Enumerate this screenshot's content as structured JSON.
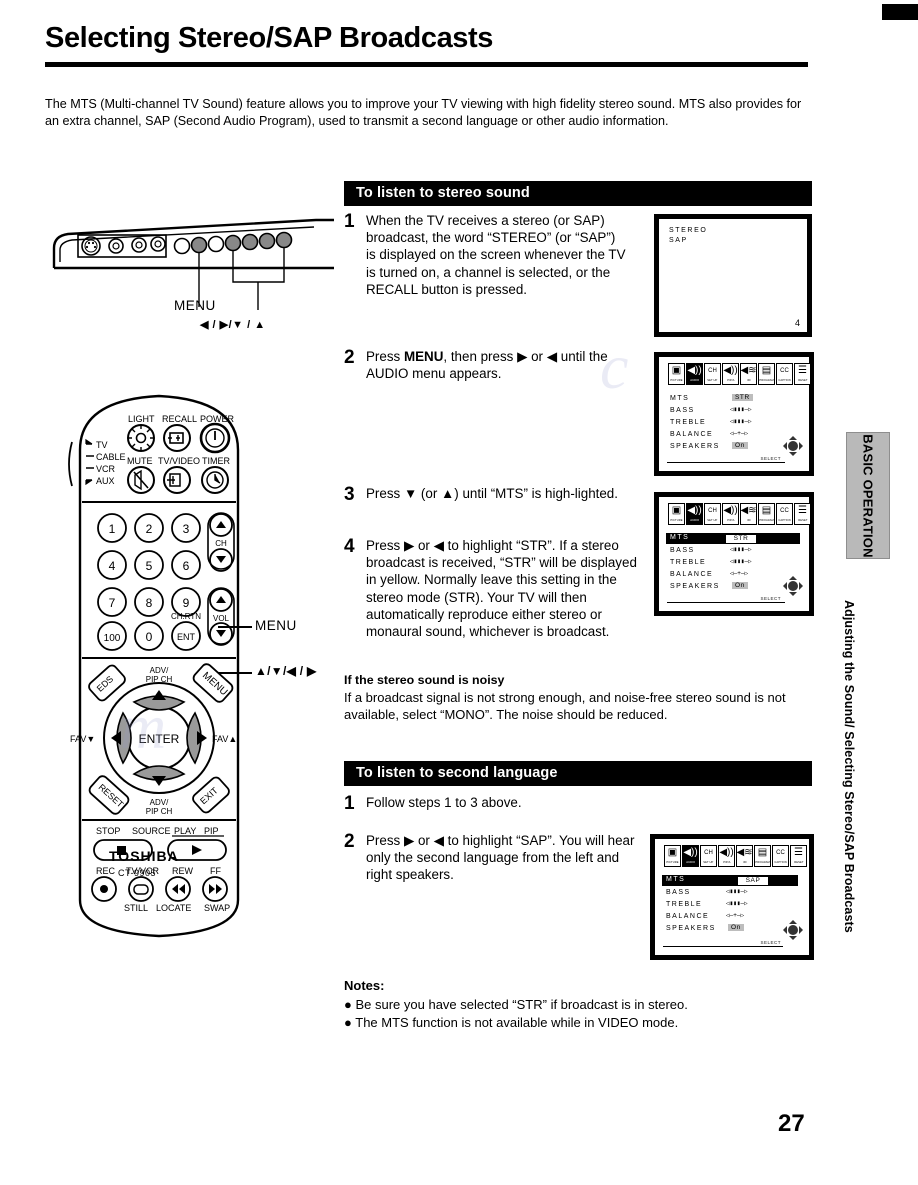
{
  "page": {
    "title": "Selecting Stereo/SAP Broadcasts",
    "number": "27",
    "intro": "The MTS (Multi-channel TV Sound) feature allows you to improve your TV viewing with high fidelity stereo sound. MTS also provides for an extra channel, SAP (Second Audio Program), used to transmit a second language or other audio information.",
    "side_tab": "BASIC OPERATION",
    "side_running_head": "Adjusting the Sound/ Selecting Stereo/SAP Broadcasts"
  },
  "tv_panel": {
    "menu_label": "MENU",
    "arrows_label": "◀ / ▶/▼ / ▲"
  },
  "remote": {
    "brand": "TOSHIBA",
    "model": "CT-9905",
    "menu_callout": "MENU",
    "arrows_callout": "▲/▼/◀ / ▶",
    "mode_labels": [
      "TV",
      "CABLE",
      "VCR",
      "AUX"
    ],
    "top_row_labels": [
      "LIGHT",
      "RECALL",
      "POWER"
    ],
    "second_row_labels": [
      "MUTE",
      "TV/VIDEO",
      "TIMER"
    ],
    "keypad": [
      "1",
      "2",
      "3",
      "4",
      "5",
      "6",
      "7",
      "8",
      "9",
      "100",
      "0",
      "ENT"
    ],
    "ent_label": "CH.RTN",
    "ch_label": "CH",
    "vol_label": "VOL",
    "dpad": {
      "center": "ENTER",
      "top_label": "ADV/\nPIP CH",
      "bottom_label": "ADV/\nPIP CH",
      "left_label": "FAV▼",
      "right_label": "FAV▲",
      "corner_tl": "EDS",
      "corner_tr": "MENU",
      "corner_bl": "RESET",
      "corner_br": "EXIT"
    },
    "transport": {
      "stop": "STOP",
      "source": "SOURCE",
      "play": "PLAY",
      "pip": "PIP",
      "rec": "REC",
      "tvvcr": "TV/VCR",
      "rew": "REW",
      "ff": "FF",
      "still": "STILL",
      "locate": "LOCATE",
      "swap": "SWAP"
    }
  },
  "section_stereo": {
    "heading": "To listen to stereo sound",
    "steps": [
      {
        "num": "1",
        "text": "When the TV receives a stereo (or SAP) broadcast, the word “STEREO” (or “SAP”) is displayed on the screen whenever the TV is turned on, a channel is selected, or the RECALL button is pressed."
      },
      {
        "num": "2",
        "text_before": "Press ",
        "bold": "MENU",
        "text_after": ", then press ▶ or ◀ until the AUDIO menu appears."
      },
      {
        "num": "3",
        "text": "Press ▼ (or ▲) until “MTS” is high-lighted."
      },
      {
        "num": "4",
        "text": "Press ▶ or ◀ to highlight “STR”. If a stereo broadcast is received, “STR” will be displayed in yellow. Normally leave this setting in the stereo mode (STR). Your TV will then automatically reproduce either stereo or monaural sound, whichever is broadcast."
      }
    ],
    "noisy_heading": "If the stereo sound is noisy",
    "noisy_text": "If a broadcast signal is not strong enough, and noise-free stereo sound is not available, select “MONO”. The noise should be reduced."
  },
  "section_second_language": {
    "heading": "To listen to second language",
    "steps": [
      {
        "num": "1",
        "text": "Follow steps 1 to 3 above."
      },
      {
        "num": "2",
        "text": "Press ▶ or ◀ to highlight  “SAP”. You will hear only the second language from the left and right speakers."
      }
    ]
  },
  "notes": {
    "title": "Notes:",
    "items": [
      "Be sure you have selected “STR” if broadcast is in stereo.",
      "The MTS function is not available while in VIDEO mode."
    ]
  },
  "osd_screen_1": {
    "line1": "STEREO",
    "line2": "SAP",
    "channel": "4"
  },
  "osd_menu": {
    "icons": [
      {
        "caption": "PICTURE",
        "glyph": "⛰",
        "selected": false
      },
      {
        "caption": "AUDIO",
        "glyph": "🔊",
        "selected": true
      },
      {
        "caption": "SET UP",
        "glyph": "CH",
        "selected": false
      },
      {
        "caption": "PIP/A",
        "glyph": "🔉",
        "selected": false
      },
      {
        "caption": "3D",
        "glyph": "🔈",
        "selected": false
      },
      {
        "caption": "PROGRAM",
        "glyph": "☷",
        "selected": false
      },
      {
        "caption": "CAPTION",
        "glyph": "CC",
        "selected": false
      },
      {
        "caption": "RESET",
        "glyph": "≋",
        "selected": false
      }
    ],
    "rows": [
      "MTS",
      "BASS",
      "TREBLE",
      "BALANCE",
      "SPEAKERS"
    ],
    "speakers_value": "On",
    "hint": "SELECT"
  },
  "osd_menu_step2": {
    "mts_value": "STR",
    "mts_highlighted": false
  },
  "osd_menu_step4": {
    "mts_value": "STR",
    "mts_highlighted": true
  },
  "osd_menu_sap": {
    "mts_value": "SAP",
    "mts_highlighted": true
  }
}
